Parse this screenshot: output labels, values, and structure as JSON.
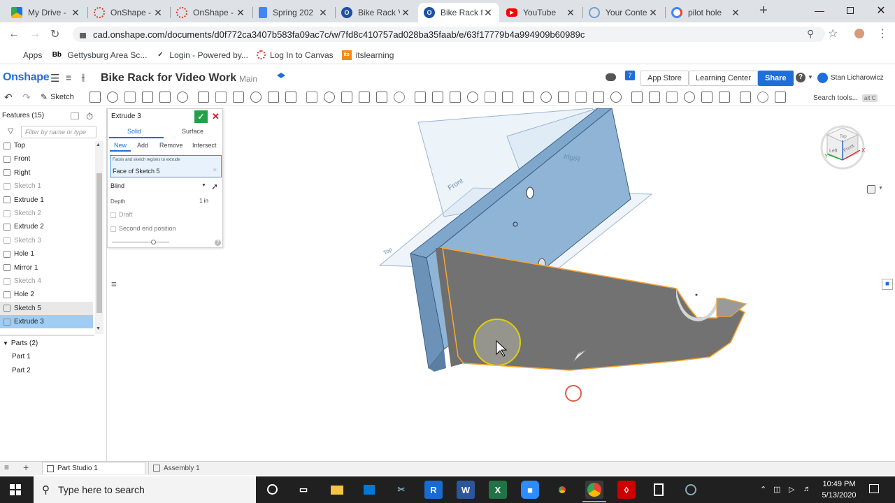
{
  "browser": {
    "tabs": [
      {
        "title": "My Drive -",
        "icon": "google-drive-icon",
        "color": "#1a73e8",
        "active": false
      },
      {
        "title": "OnShape -",
        "icon": "canvas-icon",
        "color": "#e13b2b",
        "active": false
      },
      {
        "title": "OnShape -",
        "icon": "canvas-icon",
        "color": "#e13b2b",
        "active": false
      },
      {
        "title": "Spring 202",
        "icon": "google-docs-icon",
        "color": "#4285f4",
        "active": false
      },
      {
        "title": "Bike Rack V",
        "icon": "onshape-icon",
        "color": "#1e4fa3",
        "active": false
      },
      {
        "title": "Bike Rack f",
        "icon": "onshape-icon",
        "color": "#1e4fa3",
        "active": true
      },
      {
        "title": "YouTube",
        "icon": "youtube-icon",
        "color": "#ff0000",
        "active": false
      },
      {
        "title": "Your Conte",
        "icon": "globe-icon",
        "color": "#6aa0d8",
        "active": false
      },
      {
        "title": "pilot hole",
        "icon": "google-icon",
        "color": "#4285f4",
        "active": false
      }
    ],
    "url": "cad.onshape.com/documents/d0f772ca3407b583fa09ac7c/w/7fd8c410757ad028ba35faab/e/63f17779b4a994909b60989c",
    "bookmarks": [
      {
        "label": "Apps",
        "icon": "apps-grid-icon"
      },
      {
        "label": "Gettysburg Area Sc...",
        "icon": "blackboard-icon",
        "badge": "Bb"
      },
      {
        "label": "Login - Powered by...",
        "icon": "login-icon"
      },
      {
        "label": "Log In to Canvas",
        "icon": "canvas-icon"
      },
      {
        "label": "itslearning",
        "icon": "itslearning-icon",
        "badge": "its"
      }
    ]
  },
  "onshape": {
    "logo": "Onshape",
    "doc_title": "Bike Rack for Video Work",
    "branch": "Main",
    "notif_count": "7",
    "buttons": {
      "app_store": "App Store",
      "learning_center": "Learning Center",
      "share": "Share"
    },
    "help": "?",
    "user": "Stan Licharowicz",
    "sketch_label": "Sketch",
    "search_tools": "Search tools...",
    "search_shortcut": "alt C"
  },
  "features": {
    "header": "Features (15)",
    "filter_placeholder": "Filter by name or type",
    "items": [
      {
        "label": "Top",
        "state": "normal"
      },
      {
        "label": "Front",
        "state": "normal"
      },
      {
        "label": "Right",
        "state": "normal"
      },
      {
        "label": "Sketch 1",
        "state": "dim"
      },
      {
        "label": "Extrude 1",
        "state": "normal"
      },
      {
        "label": "Sketch 2",
        "state": "dim"
      },
      {
        "label": "Extrude 2",
        "state": "normal"
      },
      {
        "label": "Sketch 3",
        "state": "dim"
      },
      {
        "label": "Hole 1",
        "state": "normal"
      },
      {
        "label": "Mirror 1",
        "state": "normal"
      },
      {
        "label": "Sketch 4",
        "state": "dim"
      },
      {
        "label": "Hole 2",
        "state": "normal"
      },
      {
        "label": "Sketch 5",
        "state": "hover"
      },
      {
        "label": "Extrude 3",
        "state": "selected"
      }
    ],
    "parts_header": "Parts (2)",
    "parts": [
      "Part 1",
      "Part 2"
    ]
  },
  "dialog": {
    "title": "Extrude 3",
    "type_tabs": [
      "Solid",
      "Surface"
    ],
    "op_tabs": [
      "New",
      "Add",
      "Remove",
      "Intersect"
    ],
    "selection_hint": "Faces and sketch regions to extrude",
    "selection_value": "Face of Sketch 5",
    "end_type": "Blind",
    "depth_label": "Depth",
    "depth_value": "1 in",
    "draft_label": "Draft",
    "second_end_label": "Second end position",
    "help": "?"
  },
  "viewport": {
    "plane_labels": {
      "front": "Front",
      "top": "Top",
      "right": "Right"
    },
    "view_cube": {
      "top": "Top",
      "front": "Front",
      "left": "Left"
    },
    "axes": {
      "x": "X",
      "y": "Y",
      "z": "Z"
    }
  },
  "bottom_tabs": [
    {
      "label": "Part Studio 1",
      "icon": "part-studio-icon"
    },
    {
      "label": "Assembly 1",
      "icon": "assembly-icon"
    }
  ],
  "taskbar": {
    "search_placeholder": "Type here to search",
    "time": "10:49 PM",
    "date": "5/13/2020"
  }
}
